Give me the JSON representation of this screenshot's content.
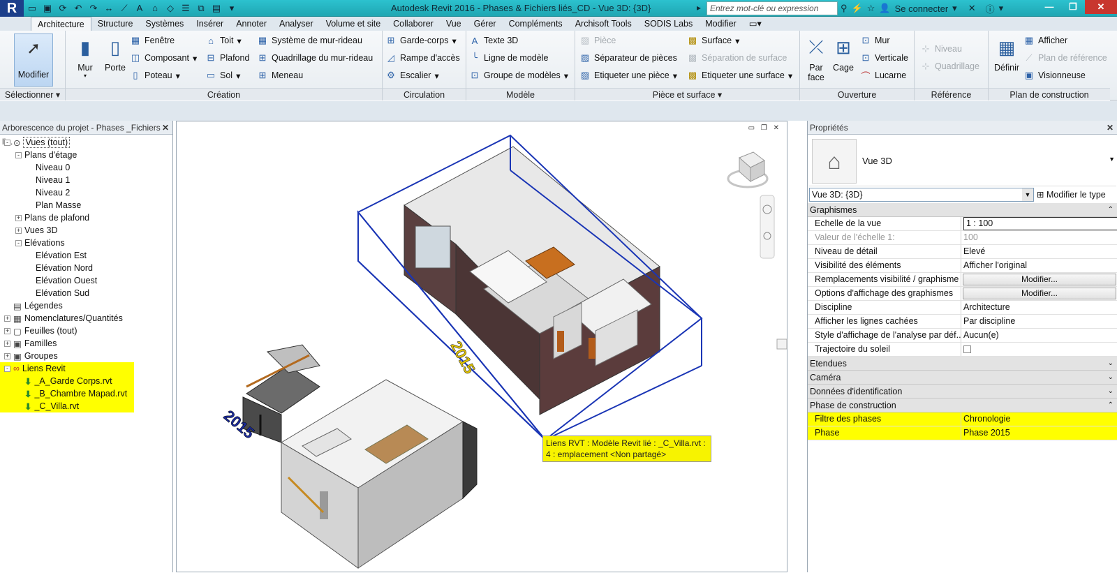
{
  "app": {
    "logo": "R",
    "title": "Autodesk Revit 2016 -     Phases & Fichiers liés_CD - Vue 3D: {3D}"
  },
  "quick_access_icons": [
    "open-icon",
    "save-icon",
    "sync-icon",
    "undo-icon",
    "redo-icon",
    "measure-icon",
    "dimension-icon",
    "text-icon",
    "3d-view-icon",
    "section-icon",
    "thin-lines-icon",
    "close-hidden-icon",
    "switch-windows-icon",
    "more-icon"
  ],
  "search": {
    "placeholder": "Entrez mot-clé ou expression"
  },
  "user": {
    "label": "Se connecter"
  },
  "tabs": [
    "Architecture",
    "Structure",
    "Systèmes",
    "Insérer",
    "Annoter",
    "Analyser",
    "Volume et site",
    "Collaborer",
    "Vue",
    "Gérer",
    "Compléments",
    "Archisoft Tools",
    "SODIS Labs",
    "Modifier"
  ],
  "ribbon": {
    "select": {
      "button": "Modifier",
      "label": "Sélectionner"
    },
    "creation": {
      "label": "Création",
      "mur": "Mur",
      "porte": "Porte",
      "fenetre": "Fenêtre",
      "composant": "Composant",
      "poteau": "Poteau",
      "toit": "Toit",
      "plafond": "Plafond",
      "sol": "Sol",
      "systeme_mur_rideau": "Système de mur-rideau",
      "quadrillage_mur_rideau": "Quadrillage du mur-rideau",
      "meneau": "Meneau"
    },
    "circulation": {
      "label": "Circulation",
      "garde_corps": "Garde-corps",
      "rampe": "Rampe d'accès",
      "escalier": "Escalier"
    },
    "modele": {
      "label": "Modèle",
      "texte3d": "Texte 3D",
      "ligne": "Ligne de modèle",
      "groupe": "Groupe de modèles"
    },
    "piece": {
      "label": "Pièce et surface",
      "piece": "Pièce",
      "separateur": "Séparateur de pièces",
      "etiqueter_piece": "Etiqueter une pièce",
      "surface": "Surface",
      "separation_surface": "Séparation de surface",
      "etiqueter_surface": "Etiqueter une surface"
    },
    "ouverture": {
      "label": "Ouverture",
      "par_face": "Par face",
      "cage": "Cage",
      "mur": "Mur",
      "verticale": "Verticale",
      "lucarne": "Lucarne"
    },
    "reference": {
      "label": "Référence",
      "niveau": "Niveau",
      "quadrillage": "Quadrillage"
    },
    "plan": {
      "label": "Plan de construction",
      "definir": "Définir",
      "afficher": "Afficher",
      "plan_ref": "Plan de référence",
      "visionneuse": "Visionneuse"
    }
  },
  "browser": {
    "title": "Arborescence du projet - Phases _Fichiers li...",
    "nodes": [
      {
        "label": "Vues (tout)",
        "level": 0,
        "toggle": "-"
      },
      {
        "label": "Plans d'étage",
        "level": 1,
        "toggle": "-"
      },
      {
        "label": "Niveau 0",
        "level": 2,
        "toggle": ""
      },
      {
        "label": "Niveau 1",
        "level": 2,
        "toggle": ""
      },
      {
        "label": "Niveau 2",
        "level": 2,
        "toggle": ""
      },
      {
        "label": "Plan Masse",
        "level": 2,
        "toggle": ""
      },
      {
        "label": "Plans de plafond",
        "level": 1,
        "toggle": "+"
      },
      {
        "label": "Vues 3D",
        "level": 1,
        "toggle": "+"
      },
      {
        "label": "Elévations",
        "level": 1,
        "toggle": "-"
      },
      {
        "label": "Elévation Est",
        "level": 2,
        "toggle": ""
      },
      {
        "label": "Elévation Nord",
        "level": 2,
        "toggle": ""
      },
      {
        "label": "Elévation Ouest",
        "level": 2,
        "toggle": ""
      },
      {
        "label": "Elévation Sud",
        "level": 2,
        "toggle": ""
      },
      {
        "label": "Légendes",
        "level": 0,
        "toggle": ""
      },
      {
        "label": "Nomenclatures/Quantités",
        "level": 0,
        "toggle": "+"
      },
      {
        "label": "Feuilles (tout)",
        "level": 0,
        "toggle": "+"
      },
      {
        "label": "Familles",
        "level": 0,
        "toggle": "+"
      },
      {
        "label": "Groupes",
        "level": 0,
        "toggle": "+"
      },
      {
        "label": "Liens Revit",
        "level": 0,
        "toggle": "-"
      },
      {
        "label": "_A_Garde Corps.rvt",
        "level": 1,
        "toggle": ""
      },
      {
        "label": "_B_Chambre Mapad.rvt",
        "level": 1,
        "toggle": ""
      },
      {
        "label": "_C_Villa.rvt",
        "level": 1,
        "toggle": ""
      }
    ]
  },
  "viewport": {
    "tooltip": "Liens RVT : Modèle Revit lié : _C_Villa.rvt : 4 : emplacement <Non partagé>",
    "phase_tag": "2015",
    "phase_tag2": "2015"
  },
  "properties": {
    "title": "Propriétés",
    "type_name": "Vue 3D",
    "selector": "Vue 3D: {3D}",
    "modify_type": "Modifier le type",
    "groups": {
      "graphismes": "Graphismes",
      "etendues": "Etendues",
      "camera": "Caméra",
      "donnees": "Données d'identification",
      "phase": "Phase de construction"
    },
    "rows": [
      {
        "name": "Echelle de la vue",
        "value": "1 : 100"
      },
      {
        "name": "Valeur de l'échelle    1:",
        "value": "100"
      },
      {
        "name": "Niveau de détail",
        "value": "Elevé"
      },
      {
        "name": "Visibilité des éléments",
        "value": "Afficher l'original"
      },
      {
        "name": "Remplacements visibilité / graphisme",
        "value": "Modifier..."
      },
      {
        "name": "Options d'affichage des graphismes",
        "value": "Modifier..."
      },
      {
        "name": "Discipline",
        "value": "Architecture"
      },
      {
        "name": "Afficher les lignes cachées",
        "value": "Par discipline"
      },
      {
        "name": "Style d'affichage de l'analyse par déf...",
        "value": "Aucun(e)"
      },
      {
        "name": "Trajectoire du soleil",
        "value": ""
      }
    ],
    "phase_rows": [
      {
        "name": "Filtre des phases",
        "value": "Chronologie"
      },
      {
        "name": "Phase",
        "value": "Phase 2015"
      }
    ]
  }
}
